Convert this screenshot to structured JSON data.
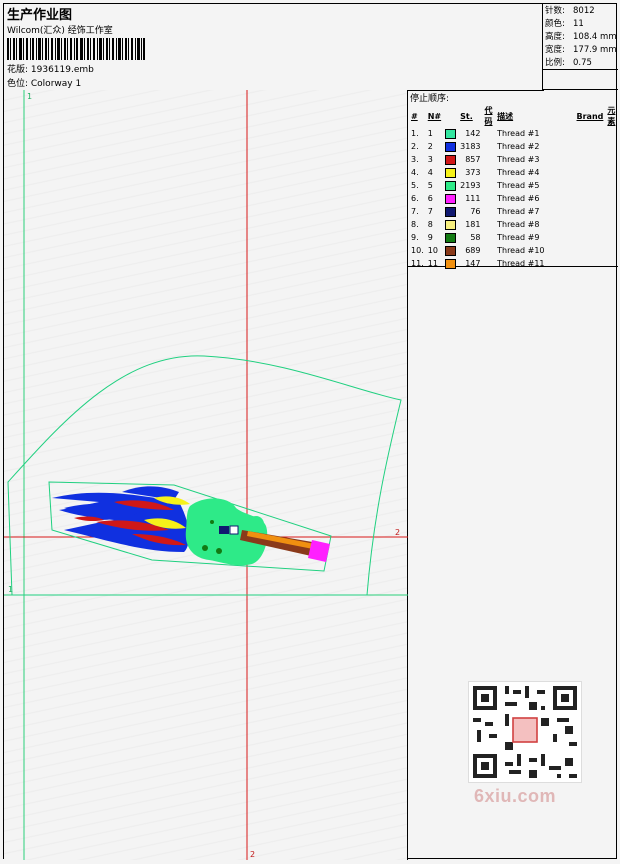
{
  "header": {
    "title": "生产作业图",
    "company": "Wilcom(汇众) 经饰工作室",
    "design": "花版:  1936119.emb",
    "colorway": "色位:  Colorway 1"
  },
  "stats": [
    {
      "label": "针数:",
      "value": "8012"
    },
    {
      "label": "颜色:",
      "value": "11"
    },
    {
      "label": "高度:",
      "value": "108.4 mm"
    },
    {
      "label": "宽度:",
      "value": "177.9 mm"
    },
    {
      "label": "比例:",
      "value": "0.75"
    }
  ],
  "stop_sequence": {
    "title": "停止顺序:",
    "headers": [
      "#",
      "N#",
      "St.",
      "代码",
      "描述",
      "Brand",
      "元素"
    ],
    "rows": [
      {
        "idx": "1.",
        "n": "1",
        "color": "#33e6a0",
        "st": "142",
        "desc": "Thread #1"
      },
      {
        "idx": "2.",
        "n": "2",
        "color": "#1030e0",
        "st": "3183",
        "desc": "Thread #2"
      },
      {
        "idx": "3.",
        "n": "3",
        "color": "#d01818",
        "st": "857",
        "desc": "Thread #3"
      },
      {
        "idx": "4.",
        "n": "4",
        "color": "#f6f21a",
        "st": "373",
        "desc": "Thread #4"
      },
      {
        "idx": "5.",
        "n": "5",
        "color": "#2eea88",
        "st": "2193",
        "desc": "Thread #5"
      },
      {
        "idx": "6.",
        "n": "6",
        "color": "#ff20ff",
        "st": "111",
        "desc": "Thread #6"
      },
      {
        "idx": "7.",
        "n": "7",
        "color": "#101870",
        "st": "76",
        "desc": "Thread #7"
      },
      {
        "idx": "8.",
        "n": "8",
        "color": "#f8f080",
        "st": "181",
        "desc": "Thread #8"
      },
      {
        "idx": "9.",
        "n": "9",
        "color": "#127a12",
        "st": "58",
        "desc": "Thread #9"
      },
      {
        "idx": "10.",
        "n": "10",
        "color": "#8a3a1a",
        "st": "689",
        "desc": "Thread #10"
      },
      {
        "idx": "11.",
        "n": "11",
        "color": "#f09010",
        "st": "147",
        "desc": "Thread #11"
      }
    ]
  },
  "canvas": {
    "guide_labels": {
      "v1": "1",
      "h1": "1",
      "h2": "2",
      "v2": "2"
    }
  },
  "watermark": "6xiu.com"
}
